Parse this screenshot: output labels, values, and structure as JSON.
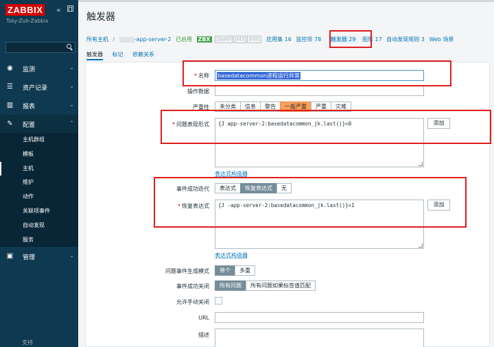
{
  "sidebar": {
    "logo": "ZABBIX",
    "collapse_icon": "«",
    "server_name": "Tsky-Zuh-Zabbix",
    "menu": [
      {
        "label": "监测",
        "icon": "eye-icon",
        "glyph": "◉",
        "chevron": "⌄"
      },
      {
        "label": "资产记录",
        "icon": "list-icon",
        "glyph": "☰",
        "chevron": "⌄"
      },
      {
        "label": "报表",
        "icon": "chart-icon",
        "glyph": "▥",
        "chevron": "⌄"
      },
      {
        "label": "配置",
        "icon": "wrench-icon",
        "glyph": "✎",
        "chevron": "⌃"
      }
    ],
    "config_items": [
      "主机群组",
      "模板",
      "主机",
      "维护",
      "动作",
      "关联项事件",
      "自动发现",
      "服务"
    ],
    "admin": {
      "label": "管理",
      "icon": "admin-icon",
      "glyph": "▣",
      "chevron": "⌄"
    },
    "support": "支持"
  },
  "page_title": "触发器",
  "hostnav": {
    "all_hosts": "所有主机",
    "separator": "/",
    "host": "-app-server-2",
    "enabled": "已启用",
    "zbx": "ZBX",
    "snmp": "SNMP",
    "jmx": "JMX",
    "ipmi": "IPMI",
    "applications": "应用集 16",
    "items": "监控项 78",
    "triggers": "触发器 29",
    "graphs": "图形 17",
    "discovery": "自动发现规则 3",
    "web": "Web 场景"
  },
  "subtabs": [
    "触发器",
    "标记",
    "依赖关系"
  ],
  "form": {
    "name_label": "名称",
    "name_value": "basedatacommon进程运行异常",
    "opdata_label": "操作数据",
    "severity_label": "严重性",
    "severity_options": [
      "未分类",
      "信息",
      "警告",
      "一般严重",
      "严重",
      "灾难"
    ],
    "severity_selected": "一般严重",
    "problem_expr_label": "问题表现形式",
    "problem_expr": "{J      app-server-2:basedatacommon_jk.last()}=0",
    "add_button": "添加",
    "expr_builder": "表达式构造器",
    "ok_event_label": "事件成功迭代",
    "ok_event_options": [
      "表达式",
      "恢复表达式",
      "无"
    ],
    "ok_event_selected": "恢复表达式",
    "recovery_expr_label": "恢复表达式",
    "recovery_expr": "{J      -app-server-2:basedatacommon_jk.last()}=1",
    "problem_gen_label": "问题事件生成模式",
    "problem_gen_options": [
      "单个",
      "多重"
    ],
    "problem_gen_selected": "单个",
    "ok_close_label": "事件成功关闭",
    "ok_close_options": [
      "所有问题",
      "所有问题如果标签值匹配"
    ],
    "ok_close_selected": "所有问题",
    "manual_close_label": "允许手动关闭",
    "url_label": "URL",
    "desc_label": "描述"
  }
}
